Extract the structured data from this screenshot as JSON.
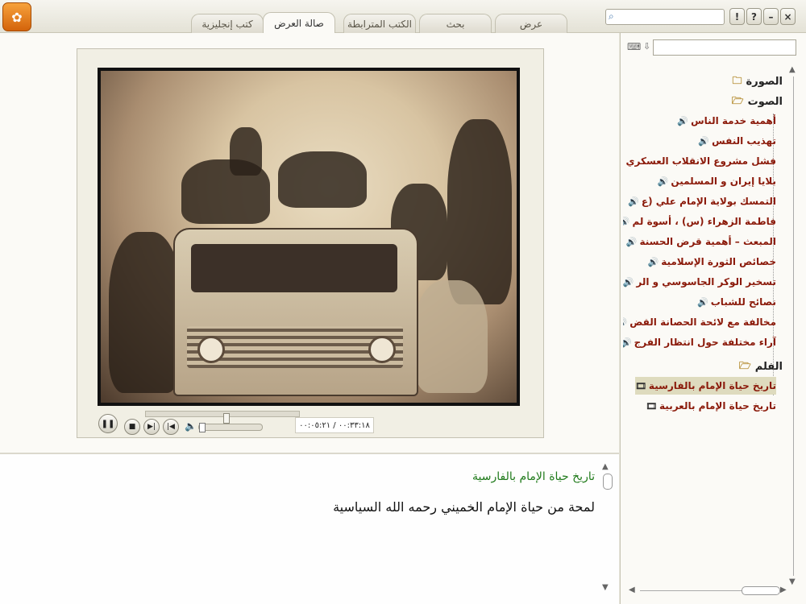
{
  "tabs": [
    {
      "label": "عرض"
    },
    {
      "label": "بحث"
    },
    {
      "label": "الكتب المترابطة"
    },
    {
      "label": "صالة العرض"
    },
    {
      "label": "كتب إنجليزية"
    }
  ],
  "window_buttons": [
    "!",
    "?",
    "–",
    "×"
  ],
  "player": {
    "time": "٠٠:٣٣:١٨ / ٠٠:٠٥:٢١"
  },
  "caption": {
    "title": "تاريخ حياة الإمام بالفارسية",
    "text": "لمحة من حياة الإمام الخميني رحمه الله السياسية"
  },
  "tree": {
    "image_folder": "الصورة",
    "audio_folder": "الصوت",
    "audio_items": [
      "أهمية خدمة الناس",
      "تهذيب النفس",
      "فشل مشروع الانقلاب العسكري",
      "بلايا إيران و المسلمين",
      "التمسك بولاية الإمام علي (ع",
      "فاطمة الزهراء (س) ، أسوة لم",
      "المبعث – أهمية قرض الحسنة",
      "خصائص الثورة الإسلامية",
      "تسخير الوكر الجاسوسي و الر",
      "نصائح للشباب",
      "مخالفة مع لائحة الحصانة القض",
      "آراء مختلفة حول انتظار الفرج"
    ],
    "film_folder": "الفلم",
    "film_items": [
      "تاريخ حياة الإمام بالفارسية",
      "تاريخ حياة الإمام بالعربية"
    ]
  }
}
